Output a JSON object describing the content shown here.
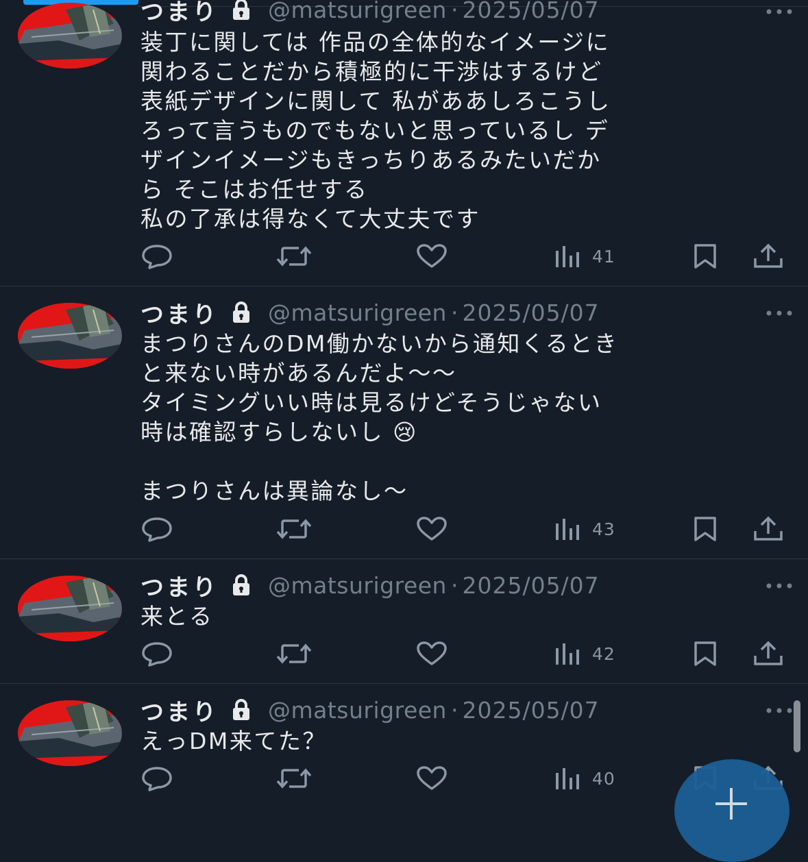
{
  "tweets": [
    {
      "name": "つまり",
      "handle": "@matsurigreen",
      "separator": "·",
      "date": "2025/05/07",
      "body": "装丁に関しては 作品の全体的なイメージに\n関わることだから積極的に干渉はするけど\n表紙デザインに関して 私がああしろこうし\nろって言うものでもないと思っているし デ\nザインイメージもきっちりあるみたいだか\nら そこはお任せする\n私の了承は得なくて大丈夫です",
      "views": "41"
    },
    {
      "name": "つまり",
      "handle": "@matsurigreen",
      "separator": "·",
      "date": "2025/05/07",
      "body": "まつりさんのDM働かないから通知くるとき\nと来ない時があるんだよ〜〜\nタイミングいい時は見るけどそうじゃない\n時は確認すらしないし 😢\n\nまつりさんは異論なし〜",
      "views": "43"
    },
    {
      "name": "つまり",
      "handle": "@matsurigreen",
      "separator": "·",
      "date": "2025/05/07",
      "body": "来とる",
      "views": "42"
    },
    {
      "name": "つまり",
      "handle": "@matsurigreen",
      "separator": "·",
      "date": "2025/05/07",
      "body": "えっDM来てた？",
      "views": "40"
    }
  ],
  "icons": {
    "reply": "reply-icon",
    "retweet": "retweet-icon",
    "like": "heart-icon",
    "views": "views-icon",
    "bookmark": "bookmark-icon",
    "share": "share-icon",
    "lock": "lock-icon",
    "more": "more-icon",
    "compose": "plus-icon"
  },
  "colors": {
    "background": "#151d28",
    "accent": "#1d9bf0",
    "muted": "#72808c",
    "fab": "#1b5f95"
  }
}
